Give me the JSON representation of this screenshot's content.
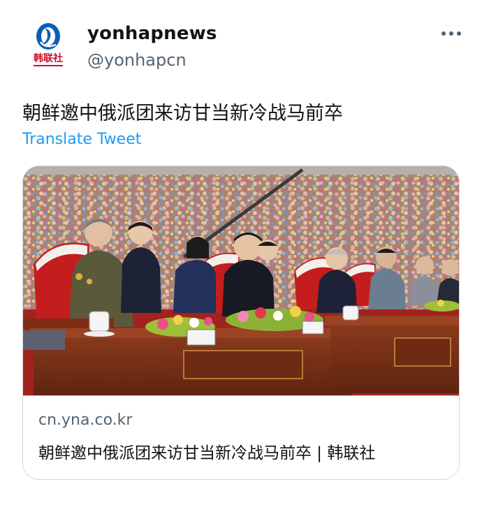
{
  "tweet": {
    "display_name": "yonhapnews",
    "handle": "@yonhapcn",
    "avatar_caption": "韩联社",
    "avatar_icon": "yonhap-logo-icon",
    "more_icon": "more-horizontal-icon",
    "text": "朝鲜邀中俄派团来访甘当新冷战马前卒",
    "translate_label": "Translate Tweet"
  },
  "card": {
    "image_description_icon": "photo",
    "domain": "cn.yna.co.kr",
    "title": "朝鲜邀中俄派团来访甘当新冷战马前卒 | 韩联社"
  },
  "colors": {
    "link_blue": "#1d9bf0",
    "secondary_text": "#536471",
    "border": "#cfd9de",
    "logo_blue": "#0a5eb5",
    "logo_red": "#c8102e"
  }
}
